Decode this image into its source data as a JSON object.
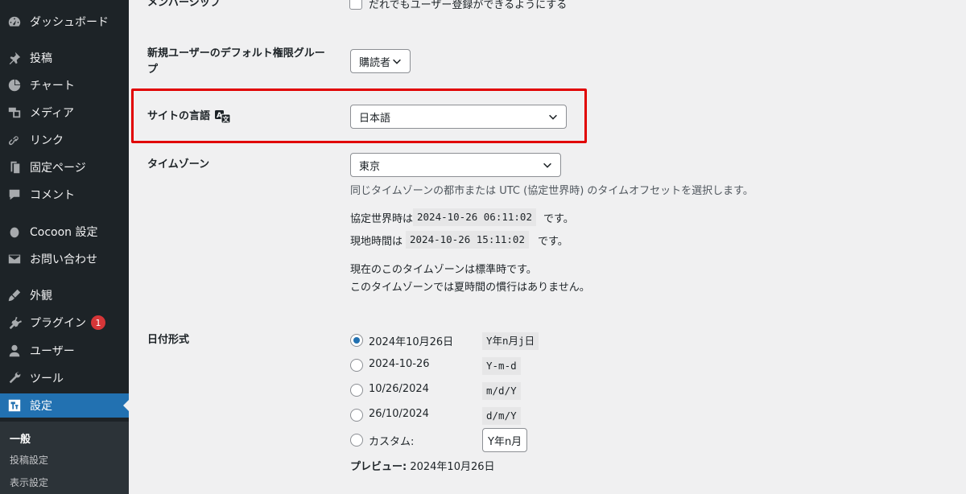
{
  "sidebar": {
    "items": [
      {
        "label": "ダッシュボード",
        "icon": "dashboard-icon"
      },
      {
        "label": "投稿",
        "icon": "pin-icon"
      },
      {
        "label": "チャート",
        "icon": "chart-icon"
      },
      {
        "label": "メディア",
        "icon": "media-icon"
      },
      {
        "label": "リンク",
        "icon": "link-icon"
      },
      {
        "label": "固定ページ",
        "icon": "page-icon"
      },
      {
        "label": "コメント",
        "icon": "comment-icon"
      },
      {
        "label": "Cocoon 設定",
        "icon": "cocoon-icon"
      },
      {
        "label": "お問い合わせ",
        "icon": "mail-icon"
      },
      {
        "label": "外観",
        "icon": "appearance-icon"
      },
      {
        "label": "プラグイン",
        "icon": "plugin-icon",
        "badge": "1"
      },
      {
        "label": "ユーザー",
        "icon": "user-icon"
      },
      {
        "label": "ツール",
        "icon": "wrench-icon"
      },
      {
        "label": "設定",
        "icon": "settings-icon",
        "active": true
      }
    ],
    "submenu": [
      {
        "label": "一般",
        "current": true
      },
      {
        "label": "投稿設定"
      },
      {
        "label": "表示設定"
      }
    ]
  },
  "settings": {
    "membership": {
      "label": "メンバーシップ",
      "checkbox_label": "だれでもユーザー登録ができるようにする"
    },
    "default_role": {
      "label": "新規ユーザーのデフォルト権限グループ",
      "value": "購読者"
    },
    "site_language": {
      "label": "サイトの言語",
      "value": "日本語"
    },
    "timezone": {
      "label": "タイムゾーン",
      "value": "東京",
      "description": "同じタイムゾーンの都市または UTC (協定世界時) のタイムオフセットを選択します。",
      "utc_prefix": "協定世界時は",
      "utc_time": "2024-10-26 06:11:02",
      "utc_suffix": "です。",
      "local_prefix": "現地時間は",
      "local_time": "2024-10-26 15:11:02",
      "local_suffix": "です。",
      "note1": "現在のこのタイムゾーンは標準時です。",
      "note2": "このタイムゾーンでは夏時間の慣行はありません。"
    },
    "date_format": {
      "label": "日付形式",
      "options": [
        {
          "label": "2024年10月26日",
          "code": "Y年n月j日",
          "checked": true
        },
        {
          "label": "2024-10-26",
          "code": "Y-m-d"
        },
        {
          "label": "10/26/2024",
          "code": "m/d/Y"
        },
        {
          "label": "26/10/2024",
          "code": "d/m/Y"
        },
        {
          "label": "カスタム:",
          "code": "Y年n月"
        }
      ],
      "preview_label": "プレビュー:",
      "preview_value": "2024年10月26日"
    }
  },
  "colors": {
    "sidebar_bg": "#1d2327",
    "active_bg": "#2271b1",
    "highlight_border": "#e10000",
    "badge_bg": "#d63638"
  }
}
